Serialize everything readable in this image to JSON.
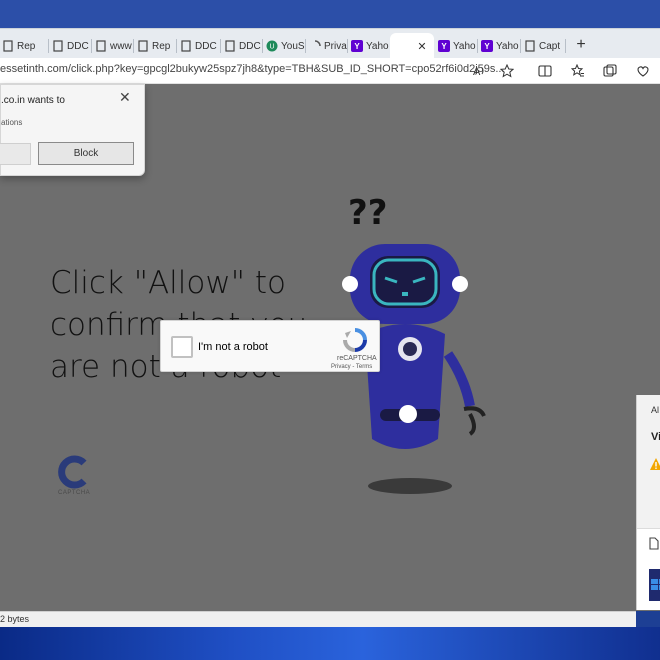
{
  "browser": {
    "tabs": [
      {
        "label": "Rep",
        "icon": "page-icon"
      },
      {
        "label": "DDC",
        "icon": "page-icon"
      },
      {
        "label": "www",
        "icon": "page-icon"
      },
      {
        "label": "Rep",
        "icon": "page-icon"
      },
      {
        "label": "DDC",
        "icon": "page-icon"
      },
      {
        "label": "DDC",
        "icon": "page-icon"
      },
      {
        "label": "YouS",
        "icon": "green-circle-icon"
      },
      {
        "label": "Priva",
        "icon": "loading-icon"
      },
      {
        "label": "Yaho",
        "icon": "yahoo-icon"
      },
      {
        "label": "",
        "icon": "close-icon"
      },
      {
        "label": "Yaho",
        "icon": "yahoo-icon"
      },
      {
        "label": "Yaho",
        "icon": "yahoo-icon"
      },
      {
        "label": "Capt",
        "icon": "page-icon"
      }
    ],
    "new_tab_symbol": "+",
    "url": "essetinth.com/click.php?key=gpcgl2bukyw25spz7jh8&type=TBH&SUB_ID_SHORT=cpo52rf6i0d2j59s..."
  },
  "notification": {
    "title": ".co.in wants to",
    "body": "ations",
    "block_label": "Block",
    "close_symbol": "✕"
  },
  "page": {
    "headline": "Click \"Allow\" to confirm that you are not a robot",
    "captcha_logo_text": "C",
    "captcha_brand": "CAPTCHA"
  },
  "recaptcha": {
    "label": "I'm not a robot",
    "brand": "reCAPTCHA",
    "links": "Privacy - Terms"
  },
  "side_panel": {
    "item_1": "Al",
    "item_2": "Vi"
  },
  "status_bar": {
    "text": "2 bytes"
  },
  "colors": {
    "page_overlay": "#6e6e6e",
    "robot_body": "#2e2e9e",
    "recaptcha_blue": "#4a90e2",
    "yahoo_purple": "#6001d2"
  }
}
